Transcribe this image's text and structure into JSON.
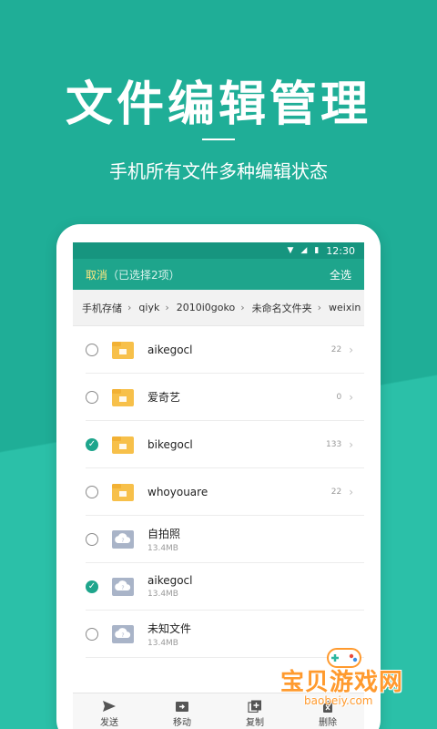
{
  "promo": {
    "title": "文件编辑管理",
    "subtitle": "手机所有文件多种编辑状态"
  },
  "status_bar": {
    "time": "12:30",
    "icons": [
      "wifi-icon",
      "signal-icon",
      "battery-icon"
    ]
  },
  "app_bar": {
    "cancel_label": "取消",
    "selection_text": "（已选择2项）",
    "select_all_label": "全选"
  },
  "breadcrumb": {
    "items": [
      "手机存储",
      "qiyk",
      "2010i0goko",
      "未命名文件夹",
      "weixin"
    ]
  },
  "files": [
    {
      "name": "aikegocl",
      "type": "folder",
      "count": "22",
      "checked": false
    },
    {
      "name": "爱奇艺",
      "type": "folder",
      "count": "0",
      "checked": false
    },
    {
      "name": "bikegocl",
      "type": "folder",
      "count": "133",
      "checked": true
    },
    {
      "name": "whoyouare",
      "type": "folder",
      "count": "22",
      "checked": false
    },
    {
      "name": "自拍照",
      "type": "unknown-file",
      "size": "13.4MB",
      "checked": false
    },
    {
      "name": "aikegocl",
      "type": "unknown-file",
      "size": "13.4MB",
      "checked": true
    },
    {
      "name": "未知文件",
      "type": "unknown-file",
      "size": "13.4MB",
      "checked": false
    }
  ],
  "bottom_bar": {
    "send_label": "发送",
    "move_label": "移动",
    "copy_label": "复制",
    "delete_label": "删除"
  },
  "watermark": {
    "text": "宝贝游戏网",
    "url": "baobeiy.com"
  },
  "colors": {
    "background": "#1fae97",
    "accent": "#1ea58c",
    "folder": "#f7c04a",
    "unknown_file": "#a9b4c8",
    "watermark": "#ff9a2e"
  }
}
